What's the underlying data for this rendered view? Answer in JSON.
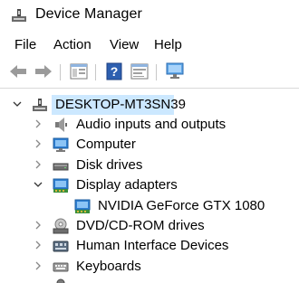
{
  "window": {
    "title": "Device Manager"
  },
  "menu": {
    "file": "File",
    "action": "Action",
    "view": "View",
    "help": "Help"
  },
  "tree": {
    "root": "DESKTOP-MT3SN39",
    "categories": [
      {
        "label": "Audio inputs and outputs",
        "icon": "speaker-icon",
        "expanded": false
      },
      {
        "label": "Computer",
        "icon": "computer-icon",
        "expanded": false
      },
      {
        "label": "Disk drives",
        "icon": "disk-drive-icon",
        "expanded": false
      },
      {
        "label": "Display adapters",
        "icon": "display-adapter-icon",
        "expanded": true,
        "children": [
          {
            "label": "NVIDIA GeForce GTX 1080",
            "icon": "display-adapter-icon"
          }
        ]
      },
      {
        "label": "DVD/CD-ROM drives",
        "icon": "dvd-drive-icon",
        "expanded": false
      },
      {
        "label": "Human Interface Devices",
        "icon": "hid-icon",
        "expanded": false
      },
      {
        "label": "Keyboards",
        "icon": "keyboard-icon",
        "expanded": false
      }
    ]
  },
  "colors": {
    "selection": "#cce8ff",
    "monitor_blue": "#2f7fd1",
    "adapter_green": "#3a8f3a"
  }
}
